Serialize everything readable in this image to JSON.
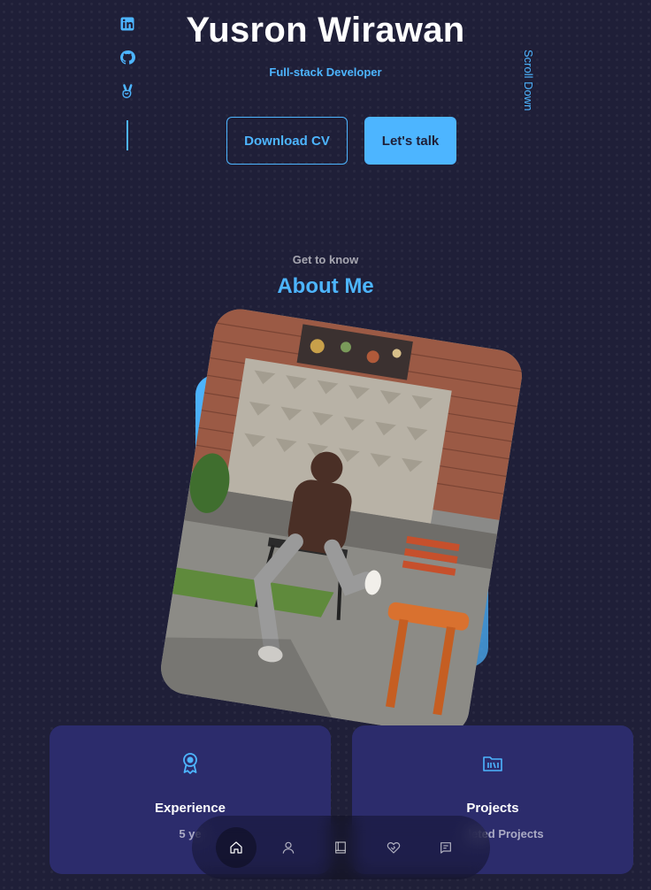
{
  "hero": {
    "name": "Yusron Wirawan",
    "role": "Full-stack Developer",
    "download_cv_label": "Download CV",
    "lets_talk_label": "Let's talk",
    "scroll_down_label": "Scroll Down",
    "socials": [
      {
        "icon": "linkedin-icon"
      },
      {
        "icon": "github-icon"
      },
      {
        "icon": "angellist-icon"
      }
    ]
  },
  "about": {
    "eyebrow": "Get to know",
    "title": "About Me",
    "photo_alt": "Profile photo",
    "cards": {
      "experience": {
        "title": "Experience",
        "subtitle": "5 ye",
        "icon": "award-icon"
      },
      "projects": {
        "title": "Projects",
        "subtitle": "leted Projects",
        "icon": "folder-icon"
      }
    }
  },
  "nav": {
    "items": [
      {
        "icon": "home-icon",
        "active": true
      },
      {
        "icon": "user-icon",
        "active": false
      },
      {
        "icon": "book-icon",
        "active": false
      },
      {
        "icon": "heart-handshake-icon",
        "active": false
      },
      {
        "icon": "message-icon",
        "active": false
      }
    ]
  },
  "colors": {
    "background": "#1f1f38",
    "accent": "#4db5ff",
    "card": "#2c2c6c"
  }
}
